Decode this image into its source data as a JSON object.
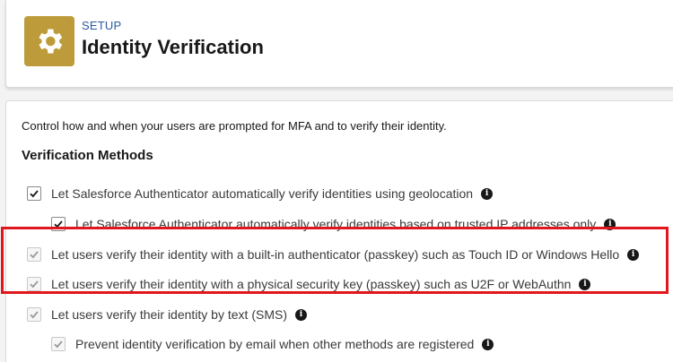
{
  "header": {
    "breadcrumb": "SETUP",
    "title": "Identity Verification",
    "icon": "gear-icon",
    "icon_color": "#bd9b3a"
  },
  "panel": {
    "intro": "Control how and when your users are prompted for MFA and to verify their identity.",
    "section_title": "Verification Methods",
    "options": [
      {
        "label": "Let Salesforce Authenticator automatically verify identities using geolocation",
        "checked": true,
        "enabled": true
      },
      {
        "label": "Let Salesforce Authenticator automatically verify identities based on trusted IP addresses only",
        "checked": true,
        "enabled": true
      },
      {
        "label": "Let users verify their identity with a built-in authenticator (passkey) such as Touch ID or Windows Hello",
        "checked": true,
        "enabled": false
      },
      {
        "label": "Let users verify their identity with a physical security key (passkey) such as U2F or WebAuthn",
        "checked": true,
        "enabled": false
      },
      {
        "label": "Let users verify their identity by text (SMS)",
        "checked": true,
        "enabled": false
      },
      {
        "label": "Prevent identity verification by email when other methods are registered",
        "checked": true,
        "enabled": false
      }
    ]
  },
  "colors": {
    "highlight": "#e0171d",
    "link": "#2c5aa0",
    "check_enabled": "#181818",
    "check_disabled": "#9a9a9a"
  }
}
